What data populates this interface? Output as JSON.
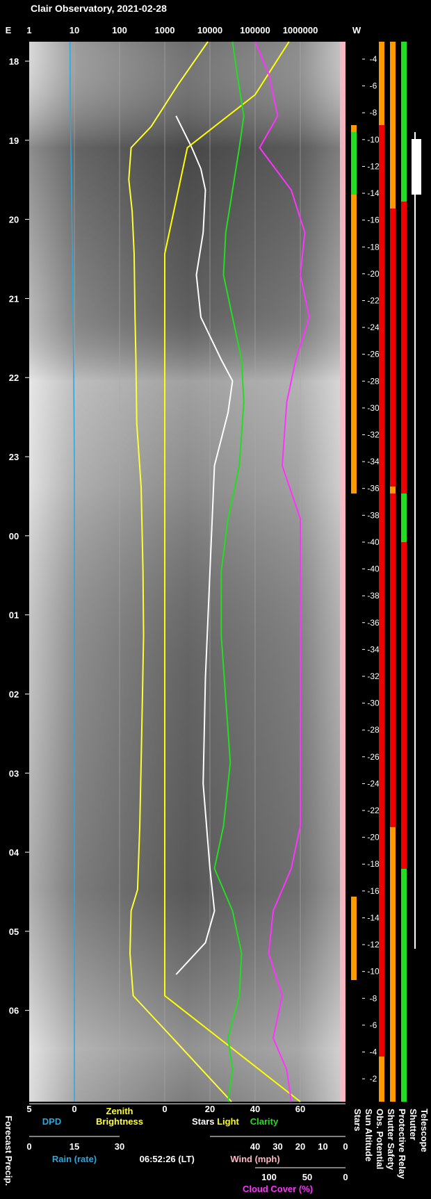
{
  "title": "Clair Observatory, 2021-02-28",
  "timestamp": "06:52:26 (LT)",
  "colors": {
    "dpd": "#29a8e0",
    "zenith": "#ffff33",
    "stars": "#ffffff",
    "light": "#ffff00",
    "clarity": "#22dd22",
    "rain": "#29a8e0",
    "wind": "#ffb6c1",
    "cloud": "#ff33ff",
    "status_red": "#ee0000",
    "status_green": "#22dd22",
    "status_orange": "#ff9900",
    "status_yellow": "#ffee00"
  },
  "chart_data": {
    "type": "line",
    "top_axis": {
      "left_label": "E",
      "right_label": "W",
      "ticks": [
        "1",
        "10",
        "100",
        "1000",
        "10000",
        "100000",
        "1000000"
      ],
      "scale": "log"
    },
    "time_ticks": [
      "18",
      "19",
      "20",
      "21",
      "22",
      "23",
      "00",
      "01",
      "02",
      "03",
      "04",
      "05",
      "06"
    ],
    "sun_altitude_ticks": [
      "-4",
      "-6",
      "-8",
      "-10",
      "-12",
      "-14",
      "-16",
      "-18",
      "-20",
      "-22",
      "-24",
      "-26",
      "-28",
      "-30",
      "-32",
      "-34",
      "-36",
      "-38",
      "-40",
      "-40",
      "-38",
      "-36",
      "-34",
      "-32",
      "-30",
      "-28",
      "-26",
      "-24",
      "-22",
      "-20",
      "-18",
      "-16",
      "-14",
      "-12",
      "-10",
      "-8",
      "-6",
      "-4",
      "-2"
    ],
    "bottom_axes": {
      "dpd_ticks": [
        "5",
        "0"
      ],
      "dpd_label": "DPD",
      "zenith_label_1": "Zenith",
      "zenith_label_2": "Brightness",
      "mag_ticks": [
        "0",
        "20",
        "40",
        "60"
      ],
      "stars_label": "Stars",
      "light_label": "Light",
      "clarity_label": "Clarity",
      "rain_ticks": [
        "0",
        "15",
        "30"
      ],
      "rain_label": "Rain (rate)",
      "wind_ticks": [
        "40",
        "30",
        "20",
        "10",
        "0"
      ],
      "wind_label": "Wind (mph)",
      "cloud_ticks": [
        "100",
        "50",
        "0"
      ],
      "cloud_label": "Cloud Cover (%)",
      "forecast_label": "Forecast Precip."
    },
    "status_columns": [
      "Stars",
      "Sun Altitude",
      "Obs. Potential",
      "Shutter Safety",
      "Protective Relay",
      "Shutter",
      "Telescope"
    ],
    "series": [
      {
        "name": "DPD",
        "x": [
          0,
          0.06,
          0.12,
          0.2,
          0.3,
          0.4,
          0.5,
          0.6,
          0.7,
          0.8,
          0.9,
          1.0
        ],
        "y": [
          8,
          8.1,
          8.5,
          9.0,
          9.6,
          10,
          10,
          10,
          10,
          10,
          10,
          10
        ]
      },
      {
        "name": "Zenith Brightness",
        "x": [
          0,
          0.04,
          0.08,
          0.1,
          0.13,
          0.16,
          0.2,
          0.26,
          0.3,
          0.36,
          0.42,
          0.5,
          0.56,
          0.62,
          0.68,
          0.74,
          0.8,
          0.82,
          0.86,
          0.9,
          0.94,
          1.0
        ],
        "y": [
          9000,
          2000,
          500,
          180,
          160,
          190,
          210,
          220,
          230,
          240,
          300,
          330,
          340,
          320,
          300,
          280,
          250,
          180,
          170,
          200,
          1500,
          30000
        ]
      },
      {
        "name": "Stars",
        "x": [
          0.07,
          0.1,
          0.12,
          0.14,
          0.18,
          0.22,
          0.26,
          0.3,
          0.32,
          0.35,
          0.4,
          0.5,
          0.6,
          0.7,
          0.78,
          0.82,
          0.85,
          0.88
        ],
        "y": [
          5,
          12,
          16,
          18,
          17,
          14,
          16,
          25,
          30,
          28,
          22,
          20,
          18,
          17,
          20,
          22,
          18,
          5
        ]
      },
      {
        "name": "Light",
        "x": [
          0,
          0.05,
          0.1,
          0.2,
          0.3,
          0.4,
          0.5,
          0.6,
          0.7,
          0.8,
          0.85,
          0.9,
          0.95,
          1.0
        ],
        "y": [
          55,
          40,
          10,
          0,
          0,
          0,
          0,
          0,
          0,
          0,
          0,
          0,
          30,
          60
        ]
      },
      {
        "name": "Clarity",
        "x": [
          0,
          0.03,
          0.07,
          0.1,
          0.14,
          0.18,
          0.22,
          0.26,
          0.3,
          0.34,
          0.4,
          0.45,
          0.5,
          0.56,
          0.62,
          0.68,
          0.74,
          0.78,
          0.82,
          0.86,
          0.9,
          0.94,
          0.97,
          1.0
        ],
        "y": [
          30,
          32,
          35,
          33,
          30,
          27,
          26,
          30,
          34,
          35,
          33,
          28,
          25,
          25,
          27,
          29,
          26,
          22,
          30,
          34,
          33,
          28,
          30,
          28
        ]
      },
      {
        "name": "Cloud Cover",
        "x": [
          0,
          0.03,
          0.07,
          0.1,
          0.14,
          0.18,
          0.22,
          0.26,
          0.3,
          0.34,
          0.4,
          0.45,
          0.5,
          0.56,
          0.62,
          0.68,
          0.74,
          0.78,
          0.82,
          0.86,
          0.9,
          0.94,
          0.97,
          1.0
        ],
        "y": [
          0,
          15,
          25,
          5,
          40,
          55,
          50,
          60,
          45,
          35,
          30,
          50,
          50,
          50,
          50,
          50,
          50,
          40,
          20,
          15,
          30,
          20,
          35,
          40
        ]
      },
      {
        "name": "Wind",
        "x": [
          0,
          0.2,
          0.4,
          0.6,
          0.8,
          1.0
        ],
        "y": [
          1,
          1,
          1,
          1,
          1,
          1
        ]
      }
    ]
  }
}
